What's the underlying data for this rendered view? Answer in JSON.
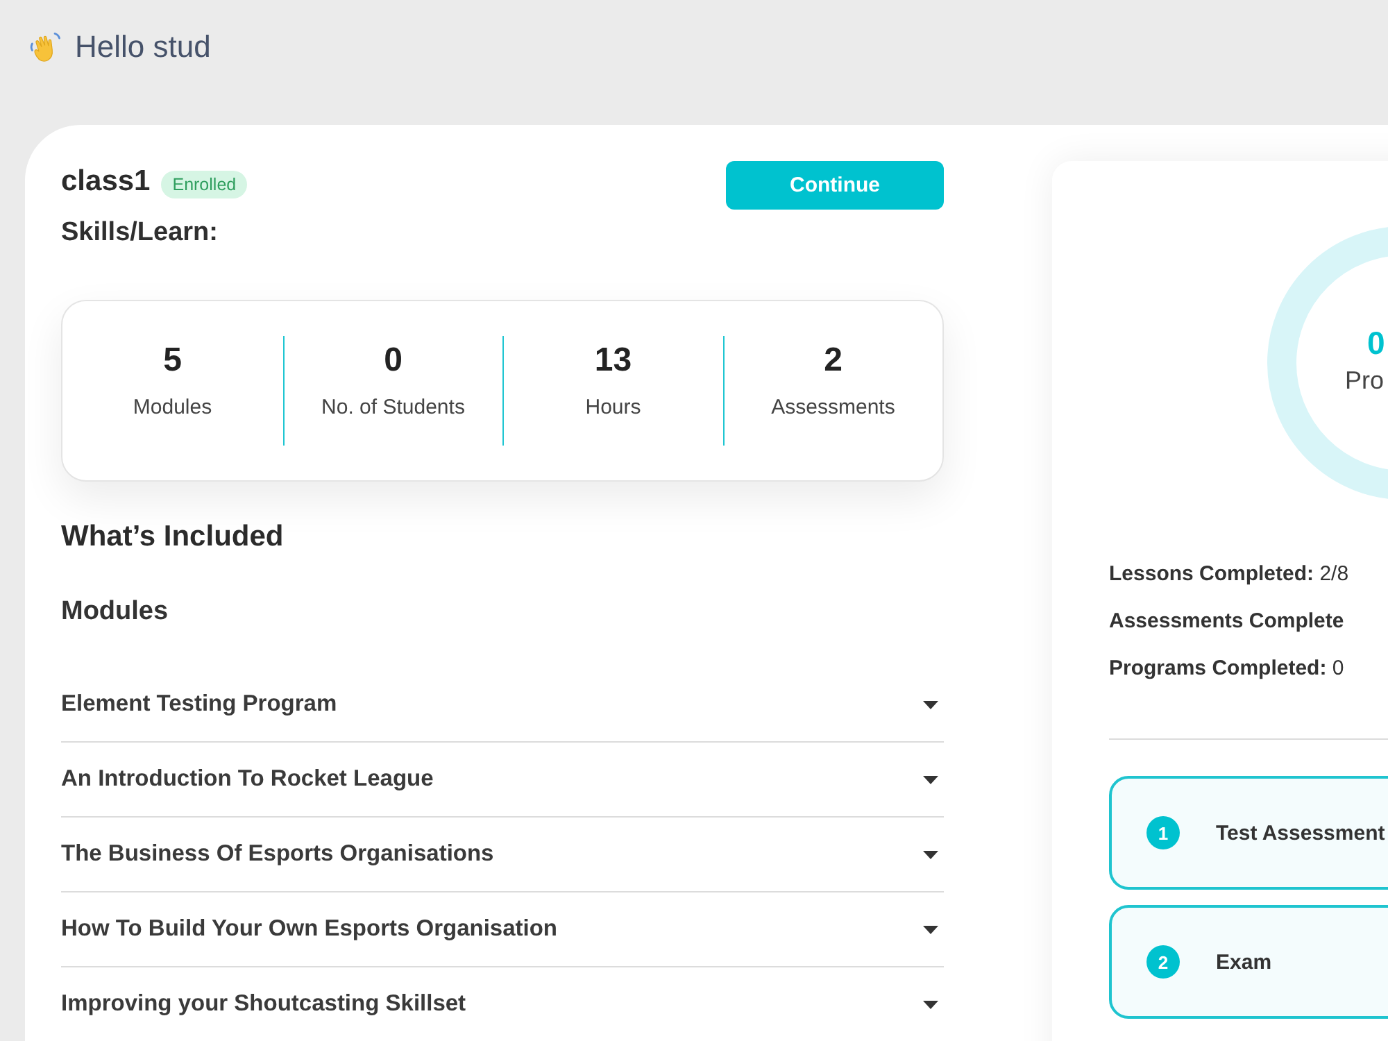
{
  "greeting": {
    "text": "Hello stud"
  },
  "course": {
    "title": "class1",
    "status": "Enrolled",
    "action": "Continue",
    "skills_label": "Skills/Learn:"
  },
  "stats": [
    {
      "value": "5",
      "label": "Modules"
    },
    {
      "value": "0",
      "label": "No. of Students"
    },
    {
      "value": "13",
      "label": "Hours"
    },
    {
      "value": "2",
      "label": "Assessments"
    }
  ],
  "included": {
    "heading": "What’s Included",
    "modules_heading": "Modules",
    "modules": [
      {
        "title": "Element Testing Program",
        "expanded": false
      },
      {
        "title": "An Introduction To Rocket League",
        "expanded": false
      },
      {
        "title": "The Business Of Esports Organisations",
        "expanded": false
      },
      {
        "title": "How To Build Your Own Esports Organisation",
        "expanded": false
      },
      {
        "title": "Improving your Shoutcasting Skillset",
        "expanded": false
      }
    ]
  },
  "progress": {
    "ring_value": "0",
    "ring_label": "Pro",
    "lines": [
      {
        "label": "Lessons Completed:",
        "value": "2/8"
      },
      {
        "label": "Assessments Complete"
      },
      {
        "label": "Programs Completed:",
        "value": "0"
      }
    ]
  },
  "assessments": [
    {
      "number": "1",
      "title": "Test Assessment"
    },
    {
      "number": "2",
      "title": "Exam"
    }
  ]
}
